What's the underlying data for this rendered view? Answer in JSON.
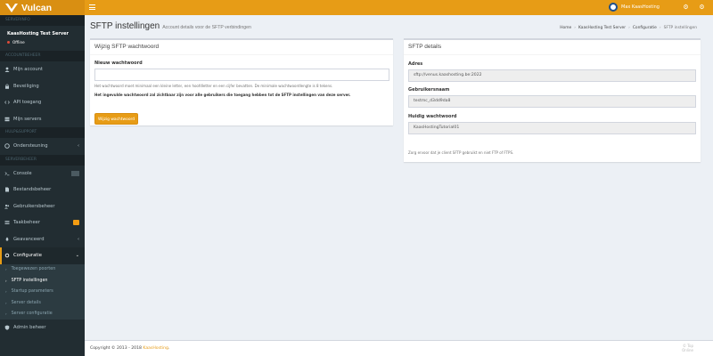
{
  "app": {
    "logo_text": "Vulcan"
  },
  "topbar": {
    "user_name": "Max KaasHosting"
  },
  "sidebar": {
    "header_servers": "SERVERINFO",
    "server_name": "KaasHosting Test Server",
    "server_status": "Offline",
    "header_account": "ACCOUNTBEHEER",
    "account_items": [
      {
        "label": "Mijn account"
      },
      {
        "label": "Beveiliging"
      },
      {
        "label": "API toegang"
      },
      {
        "label": "Mijn servers"
      }
    ],
    "header_support": "HULP&SUPPORT",
    "support_items": [
      {
        "label": "Ondersteuning"
      }
    ],
    "header_management": "SERVERBEHEER",
    "management_items": [
      {
        "label": "Console"
      },
      {
        "label": "Bestandsbeheer"
      },
      {
        "label": "Gebruikersbeheer"
      },
      {
        "label": "Taakbeheer"
      },
      {
        "label": "Geavanceerd"
      },
      {
        "label": "Configuratie"
      }
    ],
    "config_sub": [
      {
        "label": "Toegewezen poorten"
      },
      {
        "label": "SFTP instellingen"
      },
      {
        "label": "Startup parameters"
      },
      {
        "label": "Server details"
      },
      {
        "label": "Server configuratie"
      }
    ],
    "admin_item": "Admin beheer"
  },
  "page": {
    "title": "SFTP instellingen",
    "subtitle": "Account details voor de SFTP verbindingen"
  },
  "breadcrumb": [
    "Home",
    "KaasHosting Test Server",
    "Configuratie",
    "SFTP instellingen"
  ],
  "password_box": {
    "title": "Wijzig SFTP wachtwoord",
    "field_label": "Nieuw wachtwoord",
    "input_value": "",
    "help_text": "Het wachtwoord moet minimaal een kleine letter, een hoofdletter en een cijfer bevatten. De minimale wachtwoordlengte is 8 tekens.",
    "warning_text": "Het ingevulde wachtwoord zal zichtbaar zijn voor alle gebruikers die toegang hebben tot de SFTP instellingen van deze server.",
    "button_label": "Wijzig wachtwoord"
  },
  "details_box": {
    "title": "SFTP details",
    "address_label": "Adres",
    "address_value": "sftp://venus.kaashosting.be:2022",
    "username_label": "Gebruikersnaam",
    "username_value": "testmc_d3dd9da8",
    "password_label": "Huidig wachtwoord",
    "password_value": "KaasHostingTutorial01",
    "note": "Zorg ervoor dat je client SFTP gebruikt en niet FTP of FTPS."
  },
  "footer": {
    "copyright_prefix": "Copyright © 2013 - 2018",
    "company": "KaasHosting",
    "copyright_suffix": ".",
    "right_line1": "© Top",
    "right_line2": "Online"
  }
}
